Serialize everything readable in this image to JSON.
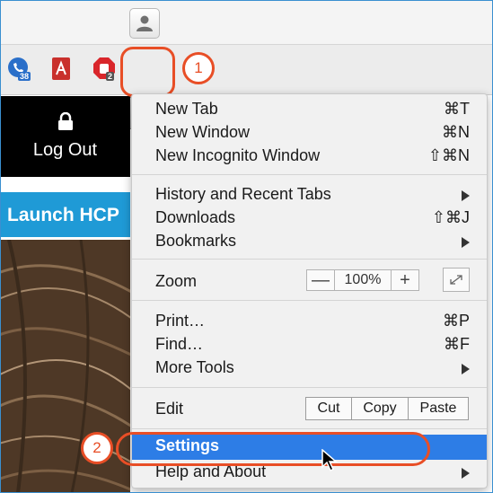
{
  "browser": {
    "extensions": [
      {
        "name": "phone-extension",
        "badge": "38"
      },
      {
        "name": "pdf-extension"
      },
      {
        "name": "stop-extension",
        "badge": "2"
      }
    ]
  },
  "page": {
    "logout_label": "Log Out",
    "launch_label": "Launch HCP"
  },
  "annotations": {
    "step1": "1",
    "step2": "2"
  },
  "menu": {
    "new_tab": {
      "label": "New Tab",
      "shortcut": "⌘T"
    },
    "new_window": {
      "label": "New Window",
      "shortcut": "⌘N"
    },
    "new_incognito": {
      "label": "New Incognito Window",
      "shortcut": "⇧⌘N"
    },
    "history": {
      "label": "History and Recent Tabs"
    },
    "downloads": {
      "label": "Downloads",
      "shortcut": "⇧⌘J"
    },
    "bookmarks": {
      "label": "Bookmarks"
    },
    "zoom": {
      "label": "Zoom",
      "minus": "—",
      "value": "100%",
      "plus": "+"
    },
    "print": {
      "label": "Print…",
      "shortcut": "⌘P"
    },
    "find": {
      "label": "Find…",
      "shortcut": "⌘F"
    },
    "more_tools": {
      "label": "More Tools"
    },
    "edit": {
      "label": "Edit",
      "cut": "Cut",
      "copy": "Copy",
      "paste": "Paste"
    },
    "settings": {
      "label": "Settings"
    },
    "help": {
      "label": "Help and About"
    }
  },
  "colors": {
    "highlight": "#2d7de6",
    "annotation": "#e84e26",
    "launch_bg": "#1f9ad6"
  }
}
